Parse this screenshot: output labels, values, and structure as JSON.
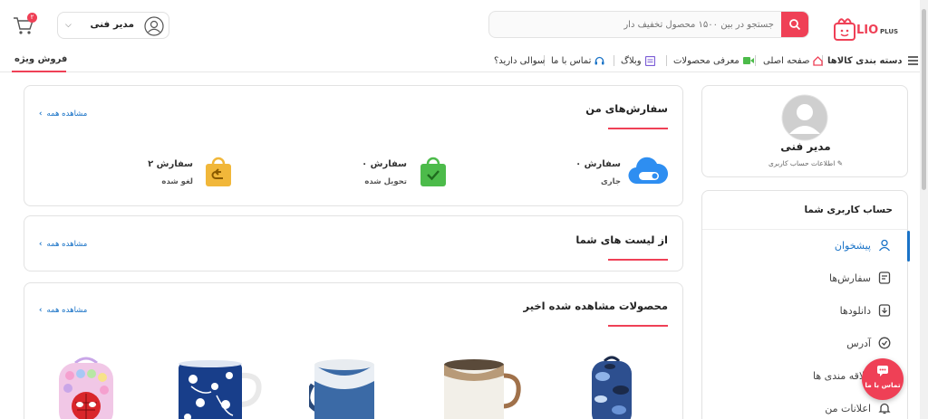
{
  "header": {
    "logo_text": "LIO",
    "logo_suffix": "PLUS",
    "search_placeholder": "جستجو در بین ۱۵۰۰ محصول تخفیف دار",
    "user_name": "مدیر فنی",
    "cart_count": "۲",
    "accent": "#ef4056"
  },
  "nav": {
    "categories": "دسته بندی کالاها",
    "home": "صفحه اصلی",
    "products": "معرفی محصولات",
    "blog": "وبلاگ",
    "contact": "تماس با ما",
    "faq": "سوالی دارید؟",
    "special": "فروش ویژه"
  },
  "profile": {
    "name": "مدیر فنی",
    "edit_label": "اطلاعات حساب کاربری"
  },
  "sidebar": {
    "title": "حساب کاربری شما",
    "items": [
      {
        "label": "پیشخوان",
        "icon": "user-icon",
        "active": true
      },
      {
        "label": "سفارش‌ها",
        "icon": "orders-icon"
      },
      {
        "label": "دانلودها",
        "icon": "download-icon"
      },
      {
        "label": "آدرس",
        "icon": "location-icon"
      },
      {
        "label": "علاقه مندی ها",
        "icon": "heart-icon"
      },
      {
        "label": "اعلانات من",
        "icon": "bell-icon"
      }
    ]
  },
  "orders": {
    "title": "سفارش‌های من",
    "see_all": "مشاهده همه",
    "stats": [
      {
        "count": "۰ سفارش",
        "label": "جاری",
        "icon": "cloud-toggle-icon",
        "color": "#2e8ef1"
      },
      {
        "count": "۰ سفارش",
        "label": "تحویل شده",
        "icon": "bag-check-icon",
        "color": "#4cbb4a"
      },
      {
        "count": "۲ سفارش",
        "label": "لغو شده",
        "icon": "bag-return-icon",
        "color": "#f1b73a"
      }
    ]
  },
  "lists": {
    "title": "از لیست های شما",
    "see_all": "مشاهده همه"
  },
  "recent": {
    "title": "محصولات مشاهده شده اخیر",
    "see_all": "مشاهده همه",
    "products": [
      {
        "name": "کوله پشتی",
        "icon": "backpack-camo-icon"
      },
      {
        "name": "ماگ",
        "icon": "mug-cream-icon"
      },
      {
        "name": "ماگ",
        "icon": "mug-blue-icon"
      },
      {
        "name": "ماگ",
        "icon": "mug-floral-icon"
      },
      {
        "name": "کوله پشتی",
        "icon": "backpack-pink-icon"
      }
    ]
  },
  "fab": {
    "label": "تماس با ما"
  }
}
